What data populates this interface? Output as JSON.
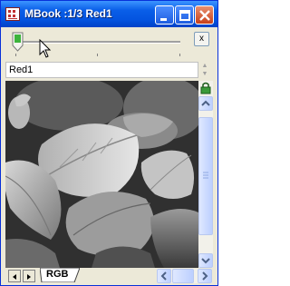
{
  "window": {
    "title": "MBook :1/3 Red1",
    "titlebar_color": "#0a5fe8",
    "buttons": [
      "minimize",
      "maximize",
      "close"
    ]
  },
  "toolbar": {
    "slider_value": "1/3",
    "close_label": "x"
  },
  "layer": {
    "name": "Red1"
  },
  "image": {
    "description_icon": "grayscale-leaves-image"
  },
  "tabs": {
    "active": "RGB"
  }
}
